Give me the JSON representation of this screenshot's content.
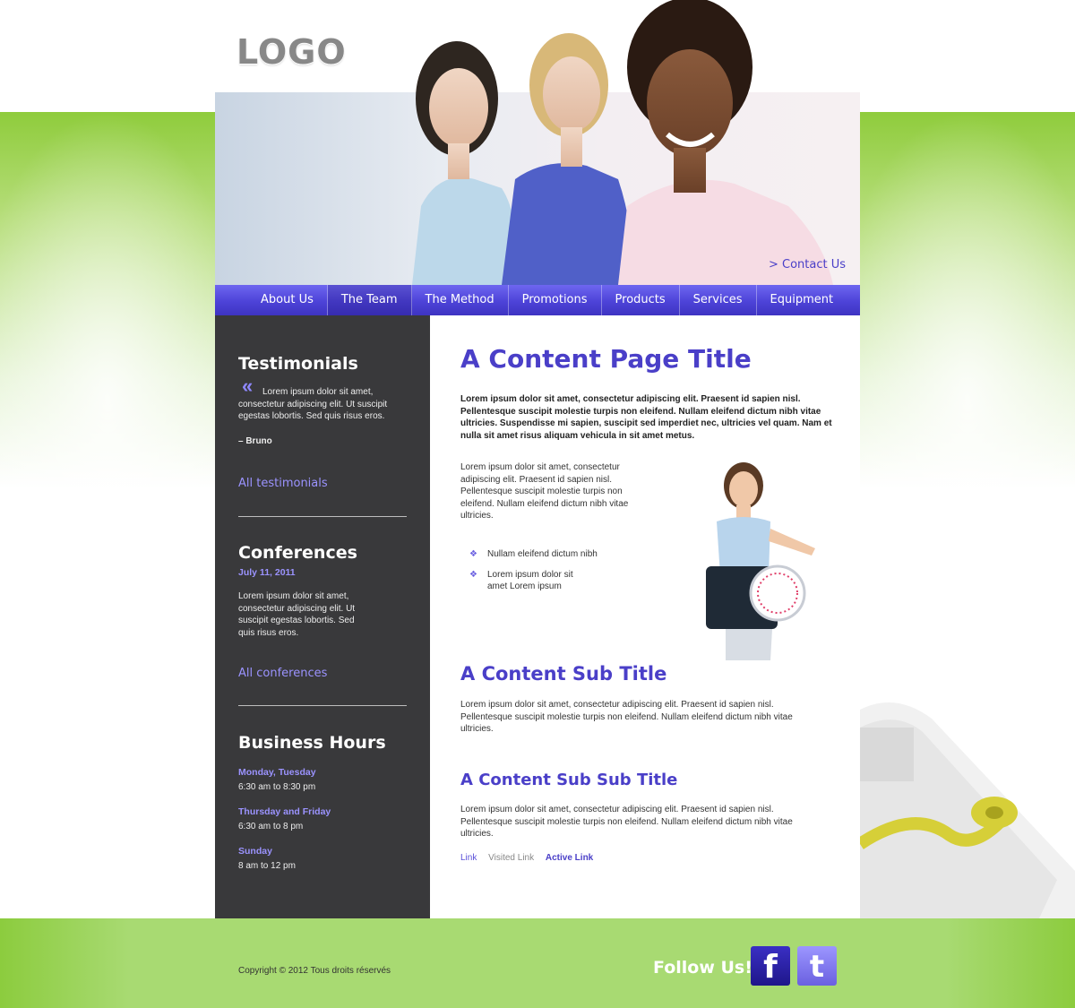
{
  "header": {
    "logo": "LOGO",
    "contact_link": ">  Contact Us"
  },
  "nav": {
    "items": [
      "About Us",
      "The Team",
      "The Method",
      "Promotions",
      "Products",
      "Services",
      "Equipment"
    ]
  },
  "sidebar": {
    "testimonials": {
      "title": "Testimonials",
      "quote_mark": "«",
      "text": "Lorem ipsum dolor sit amet, consectetur adipiscing elit. Ut suscipit egestas lobortis. Sed quis risus eros.",
      "author": "– Bruno",
      "link": "All testimonials"
    },
    "conferences": {
      "title": "Conferences",
      "date": "July 11, 2011",
      "text": "Lorem ipsum dolor sit amet, consectetur adipiscing elit. Ut suscipit egestas lobortis. Sed quis risus eros.",
      "link": "All conferences"
    },
    "hours": {
      "title": "Business Hours",
      "entries": [
        {
          "day": "Monday, Tuesday",
          "time": "6:30 am to 8:30 pm"
        },
        {
          "day": "Thursday and Friday",
          "time": "6:30 am to 8 pm"
        },
        {
          "day": "Sunday",
          "time": "8 am to 12 pm"
        }
      ]
    }
  },
  "content": {
    "title": "A Content Page Title",
    "intro_bold": "Lorem ipsum dolor sit amet, consectetur adipiscing elit. Praesent id sapien nisl. Pellentesque suscipit molestie turpis non eleifend. Nullam eleifend dictum nibh vitae ultricies. Suspendisse mi sapien, suscipit sed imperdiet nec, ultricies vel quam. Nam et nulla sit amet risus aliquam vehicula in sit amet metus.",
    "para1": "Lorem ipsum dolor sit amet, consectetur adipiscing elit. Praesent id sapien nisl. Pellentesque suscipit molestie turpis non eleifend. Nullam eleifend dictum nibh vitae ultricies.",
    "bullet_mark": "❖",
    "list": [
      "Nullam eleifend dictum nibh",
      "Lorem ipsum dolor sit amet Lorem ipsum"
    ],
    "sub_title": "A Content Sub Title",
    "sub_para": "Lorem ipsum dolor sit amet, consectetur adipiscing elit. Praesent id sapien nisl. Pellentesque suscipit molestie turpis non eleifend. Nullam eleifend dictum nibh vitae ultricies.",
    "subsub_title": "A Content Sub Sub Title",
    "subsub_para": "Lorem ipsum dolor sit amet, consectetur adipiscing elit. Praesent id sapien nisl. Pellentesque suscipit molestie turpis non eleifend. Nullam eleifend dictum nibh vitae ultricies.",
    "links": {
      "link": "Link",
      "visited": "Visited Link",
      "active": "Active Link"
    }
  },
  "footer": {
    "copyright": "Copyright © 2012 Tous droits réservés",
    "follow": "Follow Us!",
    "facebook_glyph": "f",
    "twitter_glyph": "t"
  },
  "colors": {
    "accent": "#4a3fc8",
    "green": "#a8da72",
    "sidebar": "#39393b",
    "link": "#9b93ff"
  }
}
